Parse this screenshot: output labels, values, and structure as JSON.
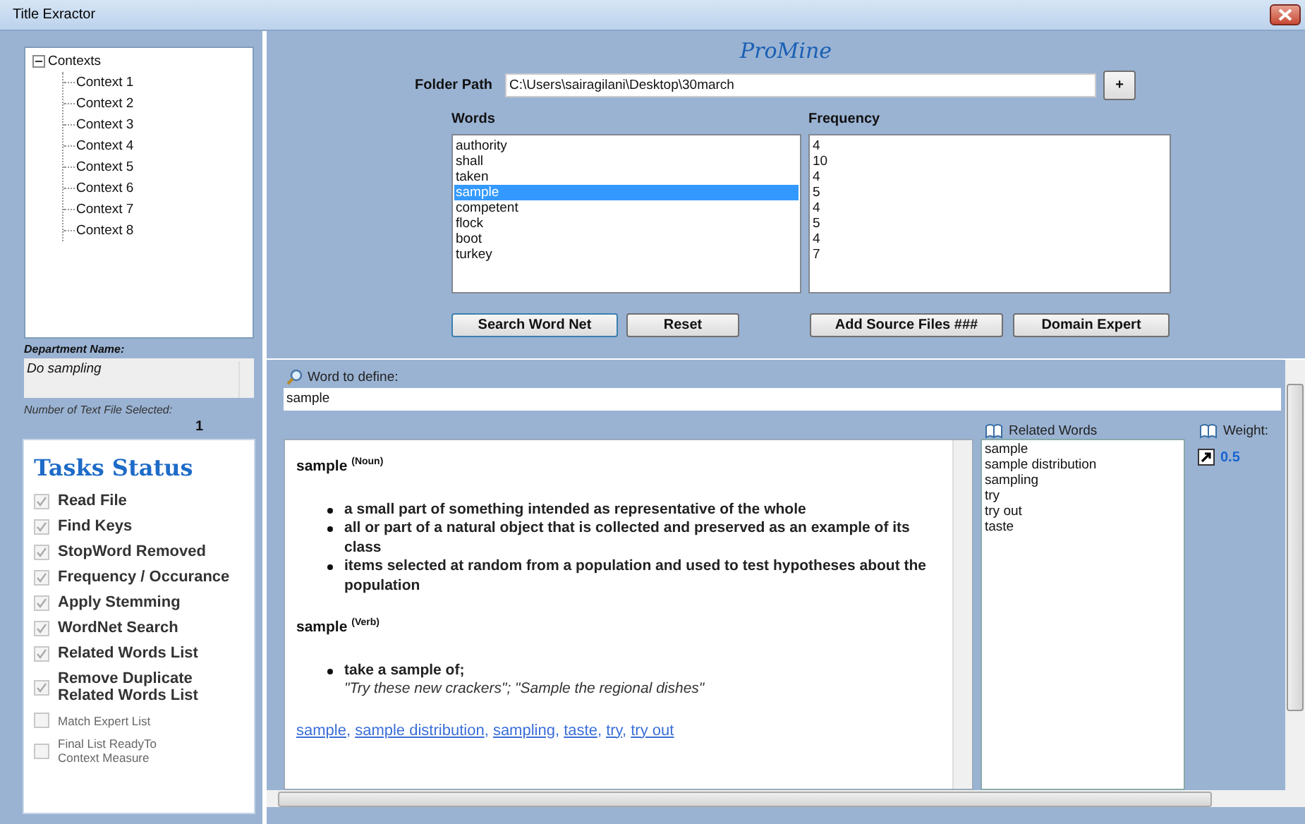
{
  "window": {
    "title": "Title Exractor"
  },
  "tree": {
    "label": "Contexts",
    "expanded": true,
    "children": [
      {
        "label": "Context 1"
      },
      {
        "label": "Context 2"
      },
      {
        "label": "Context 3"
      },
      {
        "label": "Context 4"
      },
      {
        "label": "Context 5"
      },
      {
        "label": "Context 6"
      },
      {
        "label": "Context 7"
      },
      {
        "label": "Context 8"
      }
    ]
  },
  "department": {
    "label": "Department Name:",
    "value": "Do sampling"
  },
  "file_count": {
    "label": "Number of Text File Selected:",
    "value": "1"
  },
  "tasks": {
    "title": "Tasks Status",
    "items": [
      {
        "label": "Read File",
        "checked": true,
        "kind": "major"
      },
      {
        "label": "Find Keys",
        "checked": true,
        "kind": "major"
      },
      {
        "label": "StopWord Removed",
        "checked": true,
        "kind": "major"
      },
      {
        "label": "Frequency / Occurance",
        "checked": true,
        "kind": "major"
      },
      {
        "label": "Apply Stemming",
        "checked": true,
        "kind": "major"
      },
      {
        "label": "WordNet Search",
        "checked": true,
        "kind": "major"
      },
      {
        "label": "Related Words List",
        "checked": true,
        "kind": "major"
      },
      {
        "label": "Remove Duplicate Related Words List",
        "checked": true,
        "kind": "major"
      },
      {
        "label": "Match Expert List",
        "checked": false,
        "kind": "minor"
      },
      {
        "label": "Final List ReadyTo Context Measure",
        "checked": false,
        "kind": "minor"
      }
    ]
  },
  "app_title": "ProMine",
  "folder_path": {
    "label": "Folder Path",
    "value": "C:\\Users\\sairagilani\\Desktop\\30march",
    "button": "+"
  },
  "words": {
    "label": "Words",
    "items": [
      {
        "text": "authority",
        "selected": false
      },
      {
        "text": "shall",
        "selected": false
      },
      {
        "text": "taken",
        "selected": false
      },
      {
        "text": "sample",
        "selected": true
      },
      {
        "text": "competent",
        "selected": false
      },
      {
        "text": "flock",
        "selected": false
      },
      {
        "text": "boot",
        "selected": false
      },
      {
        "text": "turkey",
        "selected": false
      }
    ]
  },
  "frequency": {
    "label": "Frequency",
    "items": [
      "4",
      "10",
      "4",
      "5",
      "4",
      "5",
      "4",
      "7"
    ]
  },
  "buttons": [
    "Search Word Net",
    "Reset",
    "Add Source Files ###",
    "Domain Expert"
  ],
  "define": {
    "label": "Word to define:",
    "value": "sample"
  },
  "definition": {
    "entries": [
      {
        "heading": "sample $^{(Noun)}$",
        "senses": [
          {
            "text": "a small part of something intended as representative of the whole"
          },
          {
            "text": "all or part of a natural object that is collected and preserved as an example of its class"
          },
          {
            "text": "items selected at random from a population and used to test hypotheses about the population"
          }
        ]
      },
      {
        "heading": "sample $^{(Verb)}$",
        "senses": [
          {
            "text": "take a sample of;",
            "example": "\"Try these new crackers\"; \"Sample the regional dishes\""
          }
        ]
      }
    ],
    "links": [
      "sample",
      "sample distribution",
      "sampling",
      "taste",
      "try",
      "try out"
    ],
    "separator": ","
  },
  "related_words": {
    "label": "Related Words",
    "items": [
      "sample",
      "sample distribution",
      "sampling",
      "try",
      "try out",
      "taste"
    ]
  },
  "weight": {
    "label": "Weight:",
    "value": "0.5"
  }
}
